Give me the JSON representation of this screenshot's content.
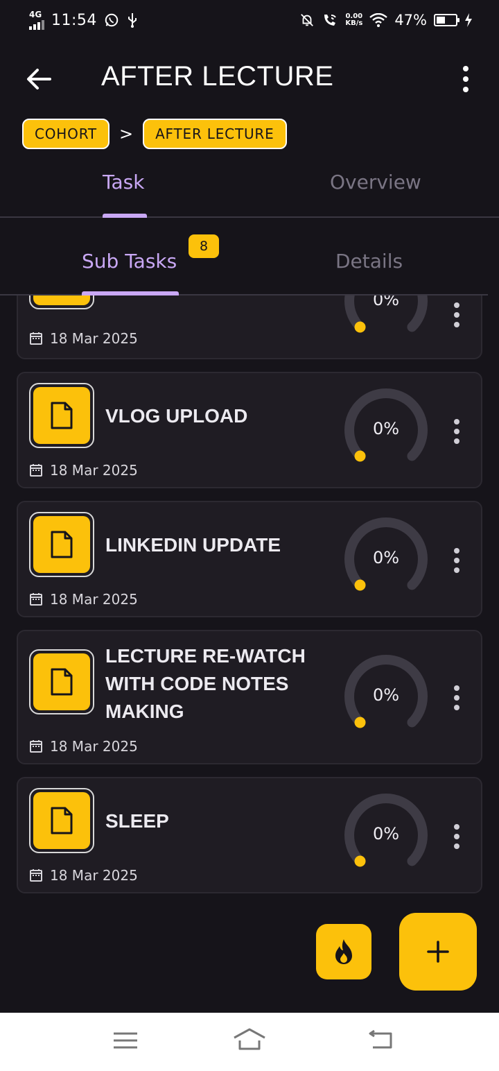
{
  "status_bar": {
    "network": "4G",
    "time": "11:54",
    "speed_top": "0.00",
    "speed_unit": "KB/s",
    "battery": "47%",
    "battery_level": 0.47,
    "icons": [
      "whatsapp-icon",
      "usb-icon",
      "mute-bell-icon",
      "wifi-call-icon",
      "wifi-icon",
      "battery-icon",
      "charging-icon"
    ]
  },
  "header": {
    "title": "AFTER LECTURE",
    "back_icon": "back-arrow-icon",
    "more_icon": "more-vertical-icon"
  },
  "breadcrumb": {
    "items": [
      "COHORT",
      "AFTER LECTURE"
    ],
    "separator": ">"
  },
  "main_tabs": {
    "items": [
      "Task",
      "Overview"
    ],
    "active": "Task"
  },
  "sub_tabs": {
    "items": [
      "Sub Tasks",
      "Details"
    ],
    "active": "Sub Tasks",
    "count": "8"
  },
  "tasks": [
    {
      "title": "",
      "date": "18 Mar 2025",
      "progress": "0%",
      "progress_value": 0
    },
    {
      "title": "VLOG UPLOAD",
      "date": "18 Mar 2025",
      "progress": "0%",
      "progress_value": 0
    },
    {
      "title": "LINKEDIN UPDATE",
      "date": "18 Mar 2025",
      "progress": "0%",
      "progress_value": 0
    },
    {
      "title_lines": [
        "LECTURE RE-WATCH",
        "WITH CODE NOTES",
        "MAKING"
      ],
      "date": "18 Mar 2025",
      "progress": "0%",
      "progress_value": 0
    },
    {
      "title": "SLEEP",
      "date": "18 Mar 2025",
      "progress": "0%",
      "progress_value": 0
    }
  ],
  "fabs": {
    "streak_icon": "flame-icon",
    "add_label": "+"
  },
  "nav": {
    "icons": [
      "menu-icon",
      "home-icon",
      "back-icon"
    ]
  },
  "colors": {
    "background": "#16141a",
    "card": "#1f1c23",
    "accent": "#fcc10b",
    "tab_active": "#c9a8f5",
    "tab_inactive": "#7a7584",
    "progress_track": "#3e3b45"
  }
}
